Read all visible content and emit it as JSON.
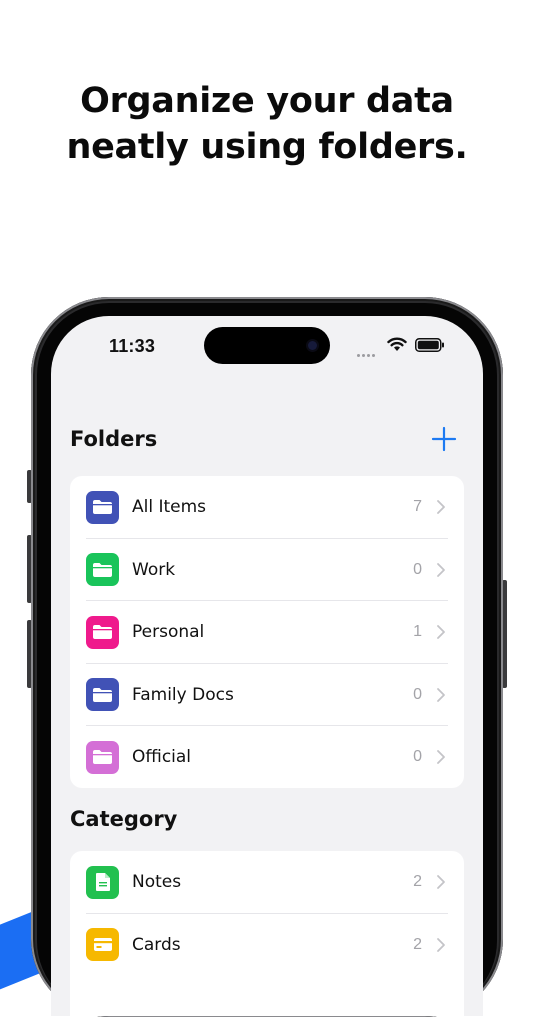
{
  "headline": {
    "line1": "Organize your data",
    "line2": "neatly using folders."
  },
  "status_bar": {
    "time": "11:33"
  },
  "folders_section": {
    "title": "Folders",
    "add_icon": "plus-icon",
    "accent_color": "#1d7af2",
    "items": [
      {
        "label": "All Items",
        "count": "7",
        "color": "#4152b6",
        "icon": "folder-icon"
      },
      {
        "label": "Work",
        "count": "0",
        "color": "#19c45a",
        "icon": "folder-icon"
      },
      {
        "label": "Personal",
        "count": "1",
        "color": "#ef1a8c",
        "icon": "folder-icon"
      },
      {
        "label": "Family Docs",
        "count": "0",
        "color": "#4152b6",
        "icon": "folder-icon"
      },
      {
        "label": "Official",
        "count": "0",
        "color": "#d46fd6",
        "icon": "folder-icon"
      }
    ]
  },
  "category_section": {
    "title": "Category",
    "items": [
      {
        "label": "Notes",
        "count": "2",
        "color": "#22c04f",
        "icon": "note-icon"
      },
      {
        "label": "Cards",
        "count": "2",
        "color": "#f6b800",
        "icon": "card-icon"
      }
    ]
  }
}
